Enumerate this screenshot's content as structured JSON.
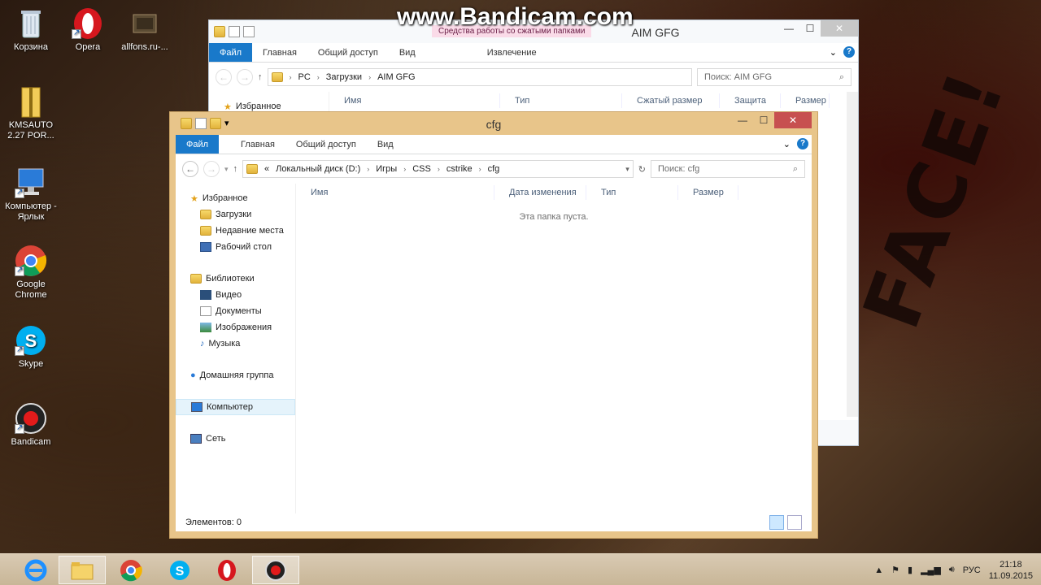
{
  "watermark": "www.Bandicam.com",
  "desktop_icons": [
    {
      "label": "Корзина"
    },
    {
      "label": "Opera"
    },
    {
      "label": "allfons.ru-..."
    },
    {
      "label": "KMSAUTO 2.27 POR..."
    },
    {
      "label": "Компьютер - Ярлык"
    },
    {
      "label": "Google Chrome"
    },
    {
      "label": "Skype"
    },
    {
      "label": "Bandicam"
    }
  ],
  "wallpaper_text": "FACE!",
  "back_window": {
    "title": "AIM GFG",
    "context_tab_group": "Средства работы со сжатыми папками",
    "tabs": [
      "Файл",
      "Главная",
      "Общий доступ",
      "Вид",
      "Извлечение"
    ],
    "path": [
      "PC",
      "Загрузки",
      "AIM GFG"
    ],
    "search_placeholder": "Поиск: AIM GFG",
    "nav_item": "Избранное",
    "columns": [
      "Имя",
      "Тип",
      "Сжатый размер",
      "Защита па...",
      "Размер"
    ]
  },
  "front_window": {
    "title": "cfg",
    "tabs": [
      "Файл",
      "Главная",
      "Общий доступ",
      "Вид"
    ],
    "path_prefix": "«",
    "path": [
      "Локальный диск (D:)",
      "Игры",
      "CSS",
      "cstrike",
      "cfg"
    ],
    "search_placeholder": "Поиск: cfg",
    "nav": {
      "favorites": "Избранное",
      "downloads": "Загрузки",
      "recent": "Недавние места",
      "desktop": "Рабочий стол",
      "libraries": "Библиотеки",
      "video": "Видео",
      "documents": "Документы",
      "images": "Изображения",
      "music": "Музыка",
      "homegroup": "Домашняя группа",
      "computer": "Компьютер",
      "network": "Сеть"
    },
    "columns": [
      "Имя",
      "Дата изменения",
      "Тип",
      "Размер"
    ],
    "empty_text": "Эта папка пуста.",
    "status": "Элементов: 0"
  },
  "taskbar": {
    "apps": [
      "Internet Explorer",
      "File Explorer",
      "Google Chrome",
      "Skype",
      "Opera",
      "Bandicam"
    ],
    "language": "РУС",
    "time": "21:18",
    "date": "11.09.2015"
  },
  "colors": {
    "ribbon_file": "#1979ca",
    "close_button": "#c75050",
    "frame_front": "#e8c58a"
  }
}
